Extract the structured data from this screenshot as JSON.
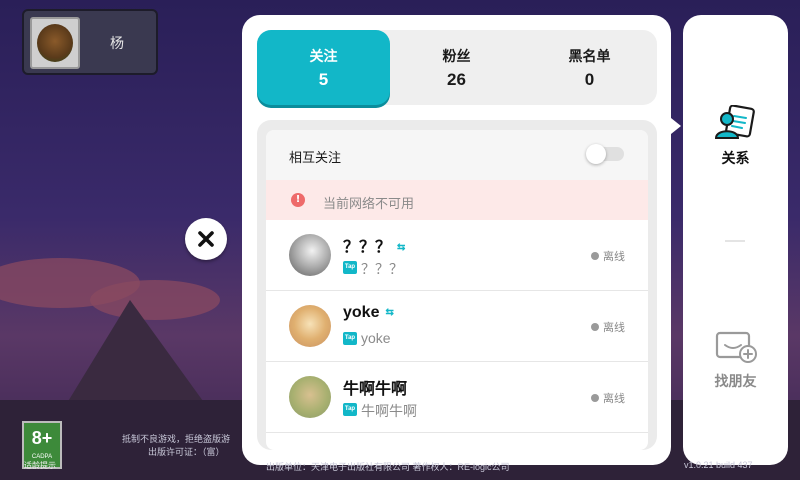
{
  "profile": {
    "name": "杨"
  },
  "tabs": [
    {
      "label": "关注",
      "count": "5",
      "active": true
    },
    {
      "label": "粉丝",
      "count": "26",
      "active": false
    },
    {
      "label": "黑名单",
      "count": "0",
      "active": false
    }
  ],
  "list": {
    "mutual_label": "相互关注",
    "mutual_toggle_on": false,
    "network_warning": "当前网络不可用",
    "friends": [
      {
        "name": "？？？",
        "tap_name": "？？？",
        "status": "离线",
        "avatar_color": "#c8c8c8"
      },
      {
        "name": "yoke",
        "tap_name": "yoke",
        "status": "离线",
        "avatar_color": "#e8cfa0"
      },
      {
        "name": "牛啊牛啊",
        "tap_name": "牛啊牛啊",
        "status": "离线",
        "avatar_color": "#b8c89a"
      }
    ],
    "tap_badge": "Tap"
  },
  "sidenav": {
    "relations_label": "关系",
    "find_friends_label": "找朋友"
  },
  "footer": {
    "age_rating": "8+",
    "age_sub": "CADPA",
    "age_caption": "适龄提示",
    "legal_line1": "抵制不良游戏，拒绝盗版游",
    "legal_line2": "出版许可证：（富）",
    "publisher": "出版单位：天津电子出版社有限公司 著作权人：RE-logic公司",
    "version": "v1.0.21   build 437"
  },
  "colors": {
    "accent": "#12b7c8",
    "warning_bg": "#fde9e8",
    "warning_icon": "#ee6a6a"
  }
}
